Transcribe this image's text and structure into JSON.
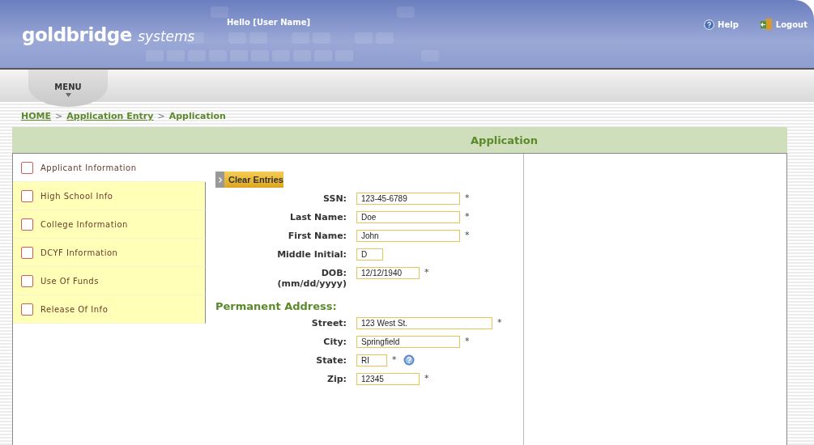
{
  "header": {
    "brand": "goldbridge",
    "brand_suffix": "systems",
    "greeting": "Hello [User Name]",
    "links": [
      {
        "label": "Help",
        "kind": "help"
      },
      {
        "label": "Logout",
        "kind": "logout"
      }
    ]
  },
  "menu": {
    "label": "MENU"
  },
  "breadcrumb": [
    {
      "label": "HOME",
      "link": true
    },
    {
      "label": "Application Entry",
      "link": true
    },
    {
      "label": "Application",
      "link": false
    }
  ],
  "breadcrumb_separator": ">",
  "panel": {
    "title": "Application"
  },
  "sidebar": {
    "items": [
      {
        "label": "Applicant Information",
        "selected": true,
        "checked": false
      },
      {
        "label": "High School Info",
        "selected": false,
        "checked": false
      },
      {
        "label": "College Information",
        "selected": false,
        "checked": false
      },
      {
        "label": "DCYF Information",
        "selected": false,
        "checked": false
      },
      {
        "label": "Use Of Funds",
        "selected": false,
        "checked": false
      },
      {
        "label": "Release Of Info",
        "selected": false,
        "checked": false
      }
    ]
  },
  "clear_button": "Clear Entries",
  "fields": [
    {
      "label": "SSN:",
      "value": "123-45-6789",
      "required": true,
      "kind": "medium"
    },
    {
      "label": "Last Name:",
      "value": "Doe",
      "required": true,
      "kind": "medium"
    },
    {
      "label": "First Name:",
      "value": "John",
      "required": true,
      "kind": "medium"
    },
    {
      "label": "Middle Initial:",
      "value": "D",
      "required": false,
      "kind": "tiny"
    },
    {
      "label": "DOB:",
      "sublabel": "(mm/dd/yyyy)",
      "value": "12/12/1940",
      "required": true,
      "kind": "short"
    }
  ],
  "address": {
    "title": "Permanent Address:",
    "fields": [
      {
        "label": "Street:",
        "value": "123 West St.",
        "required": true,
        "kind": "wide"
      },
      {
        "label": "City:",
        "value": "Springfield",
        "required": true,
        "kind": "medium"
      },
      {
        "label": "State:",
        "value": "RI",
        "required": true,
        "kind": "state",
        "help": true
      },
      {
        "label": "Zip:",
        "value": "12345",
        "required": true,
        "kind": "short"
      }
    ]
  },
  "required_mark": "*"
}
